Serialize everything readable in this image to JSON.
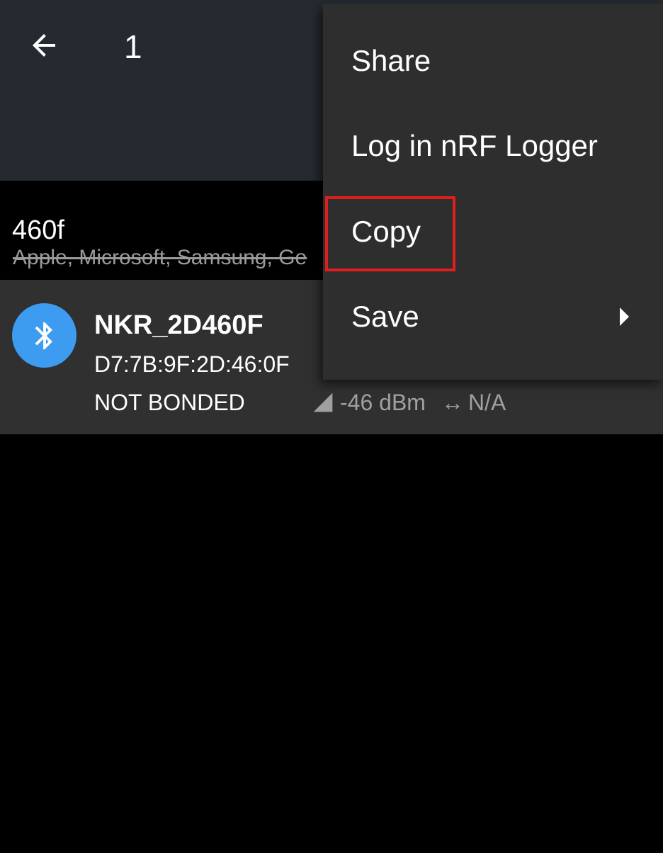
{
  "appbar": {
    "title": "1",
    "back_icon": "arrow-left-icon"
  },
  "filter": {
    "query": "460f",
    "excluded": "Apple, Microsoft, Samsung, Ge"
  },
  "device": {
    "icon": "bluetooth-icon",
    "name": "NKR_2D460F",
    "address": "D7:7B:9F:2D:46:0F",
    "bond_state": "NOT BONDED",
    "rssi": "-46 dBm",
    "interval": "N/A",
    "interval_icon": "↔"
  },
  "menu": {
    "items": [
      {
        "label": "Share"
      },
      {
        "label": "Log in nRF Logger"
      },
      {
        "label": "Copy"
      },
      {
        "label": "Save"
      }
    ]
  },
  "colors": {
    "appbar_bg": "#252a31",
    "menu_bg": "#2e2e2e",
    "row_bg": "#303030",
    "avatar_blue": "#3d9bf0",
    "highlight_red": "#e01e1e"
  }
}
